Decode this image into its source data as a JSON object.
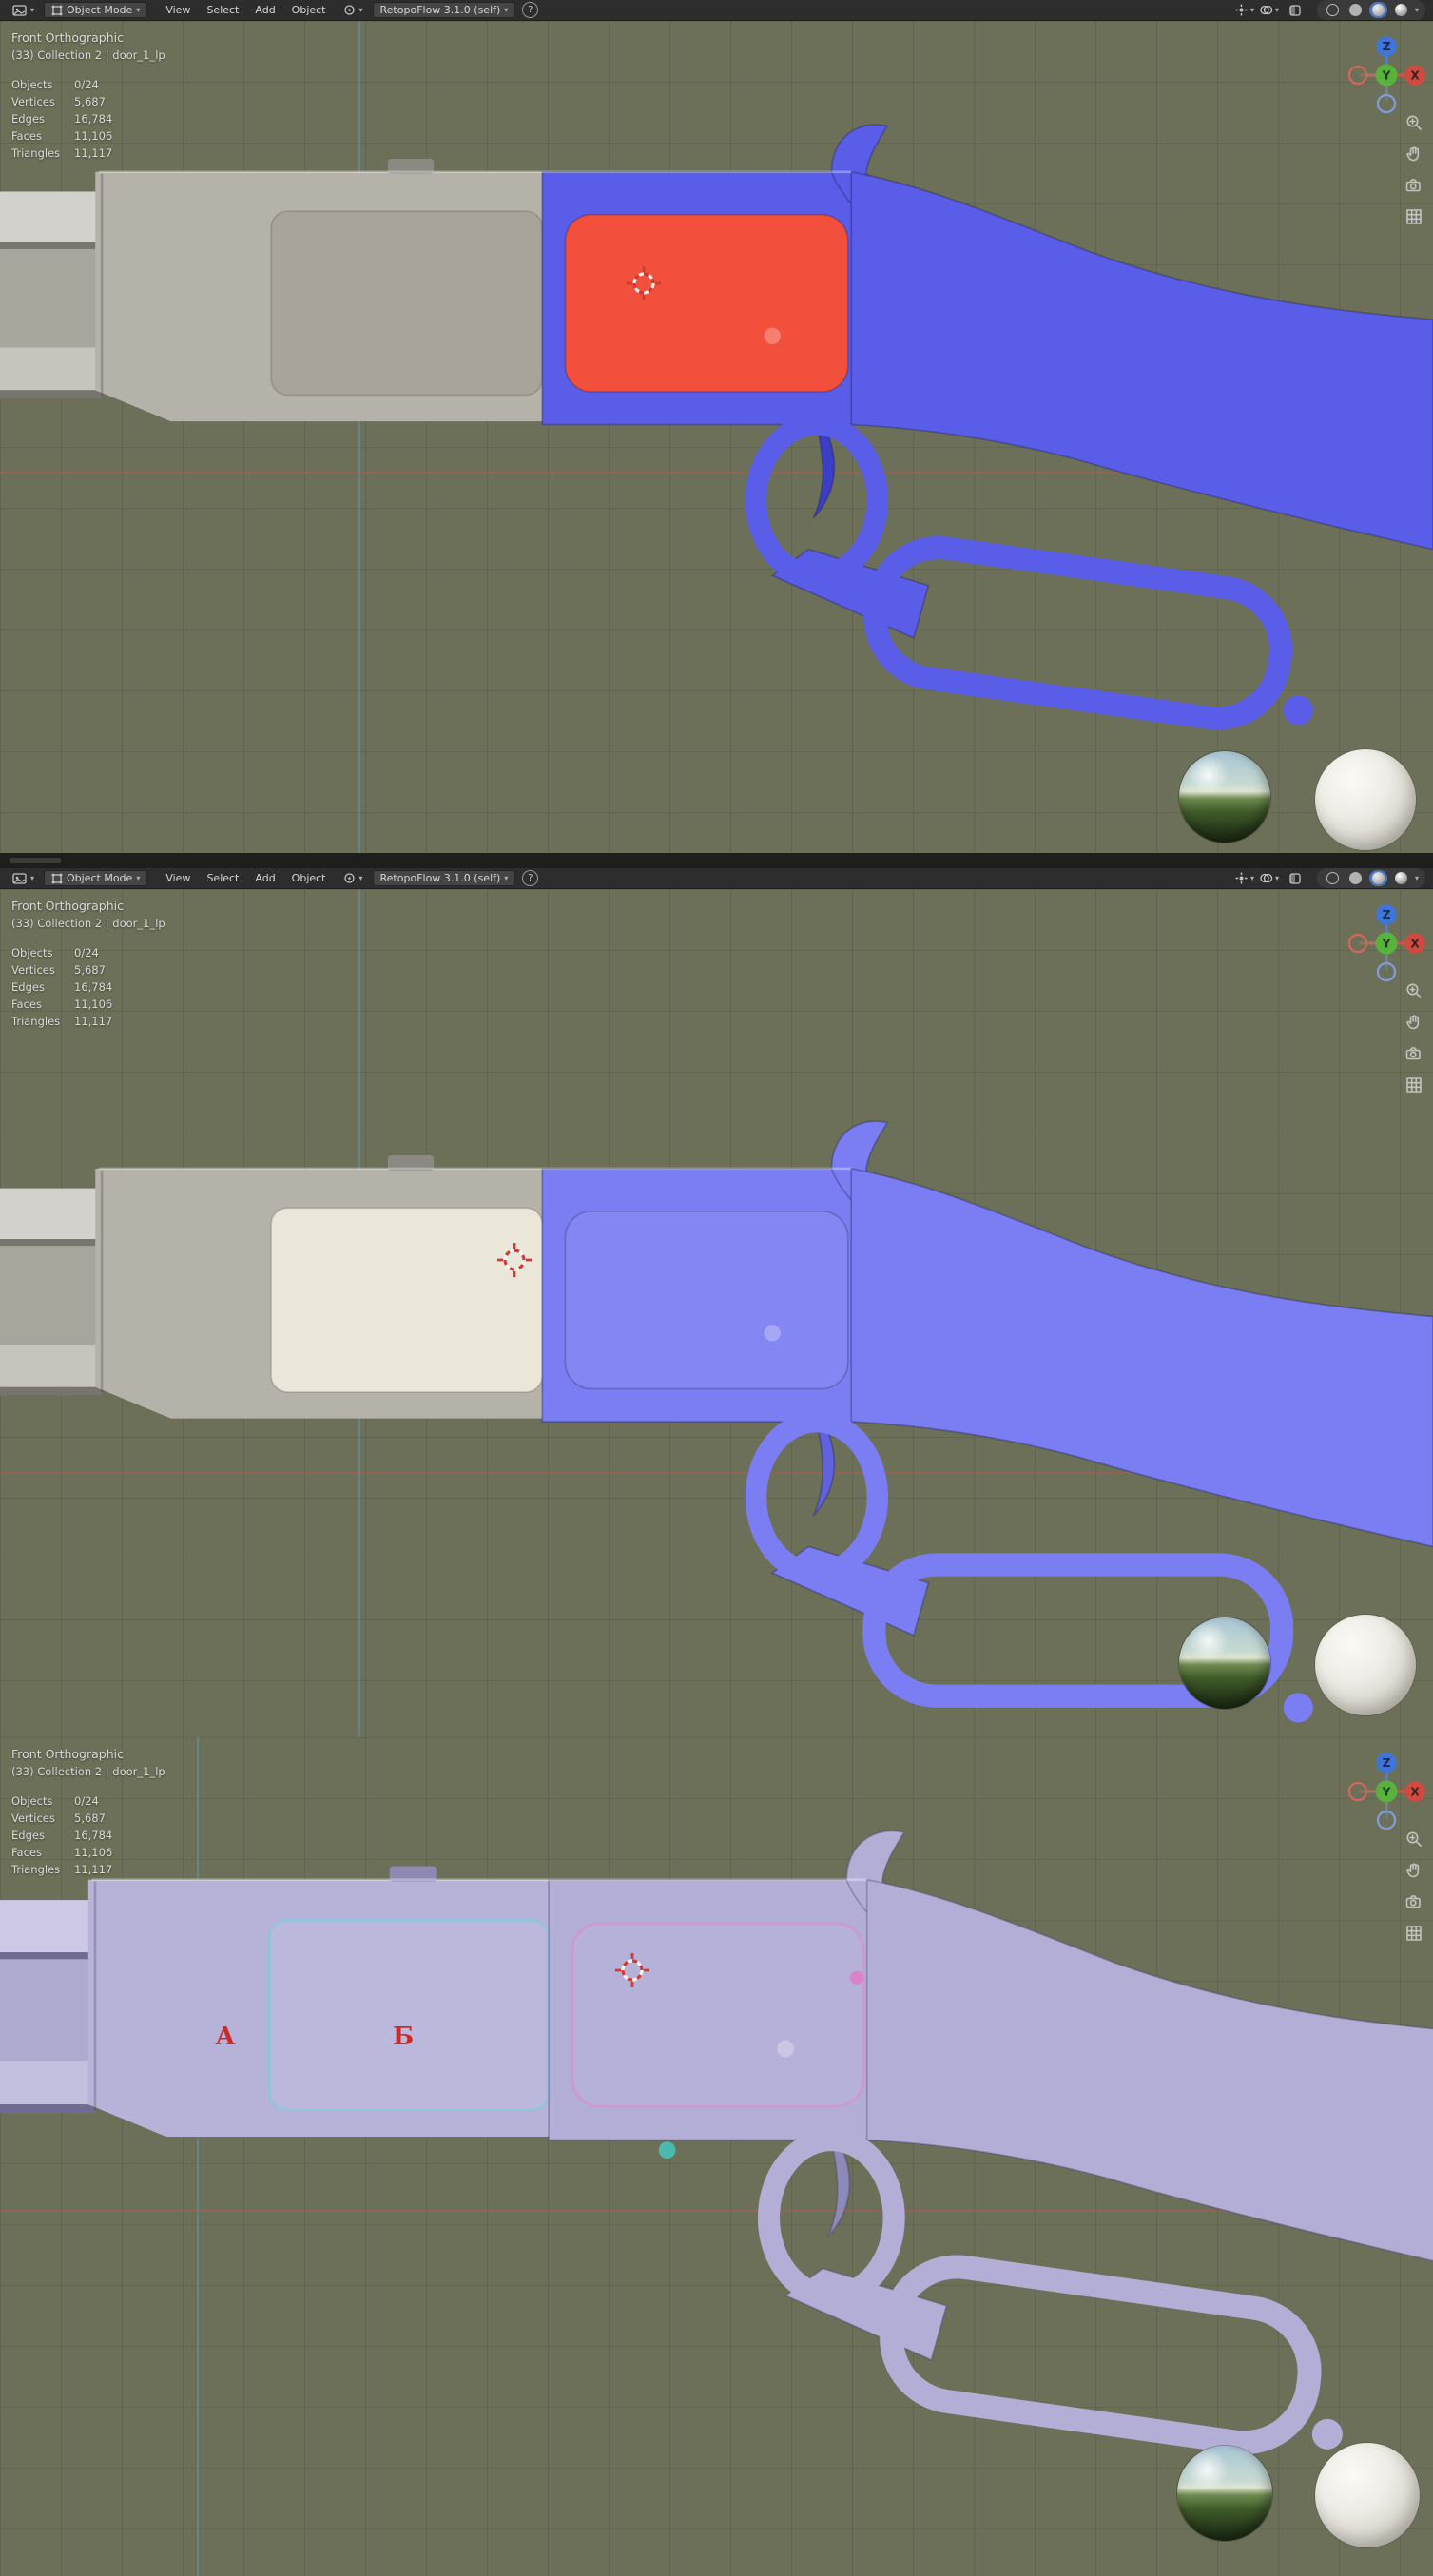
{
  "header": {
    "mode": "Object Mode",
    "menus": [
      "View",
      "Select",
      "Add",
      "Object"
    ],
    "addon_menu": "RetopoFlow 3.1.0 (self)",
    "help": "?"
  },
  "icons": {
    "caret": "▾"
  },
  "overlay": {
    "view_label": "Front Orthographic",
    "collection_label": "(33) Collection 2 | door_1_lp",
    "stats": [
      {
        "label": "Objects",
        "value": "0/24"
      },
      {
        "label": "Vertices",
        "value": "5,687"
      },
      {
        "label": "Edges",
        "value": "16,784"
      },
      {
        "label": "Faces",
        "value": "11,106"
      },
      {
        "label": "Triangles",
        "value": "11,117"
      }
    ]
  },
  "gizmo": {
    "x": "X",
    "y": "Y",
    "z": "Z"
  },
  "annotations": {
    "a": "А",
    "b": "Б",
    "color": "#cc2a26"
  },
  "colors": {
    "viewport_background": "#6c7058",
    "header_background": "#2d2d2d",
    "highlight_red": "#f2503c",
    "retopo_blue": "#5a5de8",
    "lavender": "#b3aed6"
  },
  "panels": [
    {
      "name": "retopo-red-highlight",
      "colors": {
        "overlay": "#5a5de8",
        "plate_left": "#a8a49c",
        "plate_right": "#f2503c"
      }
    },
    {
      "name": "retopo-white-highlight",
      "colors": {
        "overlay": "#7b7ef2",
        "plate_left": "#eae6da",
        "plate_right": "#8487f3"
      }
    },
    {
      "name": "annotated-lavender",
      "colors": {
        "overlay": "#b3aed6",
        "plate_left": "#bcb8dc",
        "plate_right": "#b6b1d8"
      }
    }
  ]
}
